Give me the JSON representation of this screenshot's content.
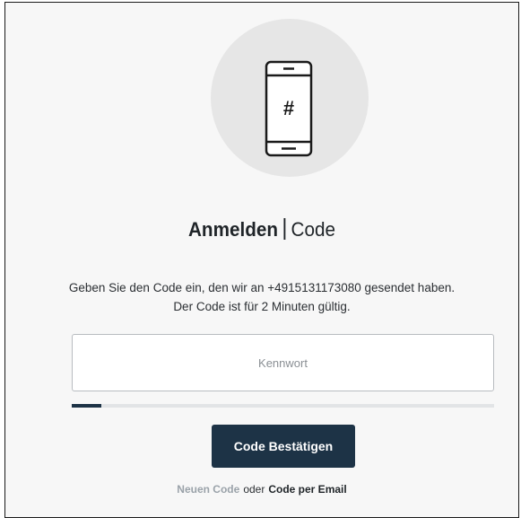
{
  "header": {
    "title_bold": "Anmelden",
    "title_light": "Code"
  },
  "illustration": {
    "icon": "smartphone-hash-icon",
    "symbol": "#"
  },
  "description": {
    "line1": "Geben Sie den Code ein, den wir an +4915131173080 gesendet haben.",
    "line2": "Der Code ist für 2 Minuten gültig."
  },
  "code_input": {
    "placeholder": "Kennwort",
    "value": ""
  },
  "timer_progress": {
    "fraction": 0.07
  },
  "actions": {
    "confirm_label": "Code Bestätigen",
    "new_code_label": "Neuen Code",
    "or_label": "oder",
    "email_code_label": "Code per Email"
  },
  "colors": {
    "accent": "#1d3346",
    "muted_link": "#9aa2a9",
    "circle_bg": "#e6e6e6"
  }
}
